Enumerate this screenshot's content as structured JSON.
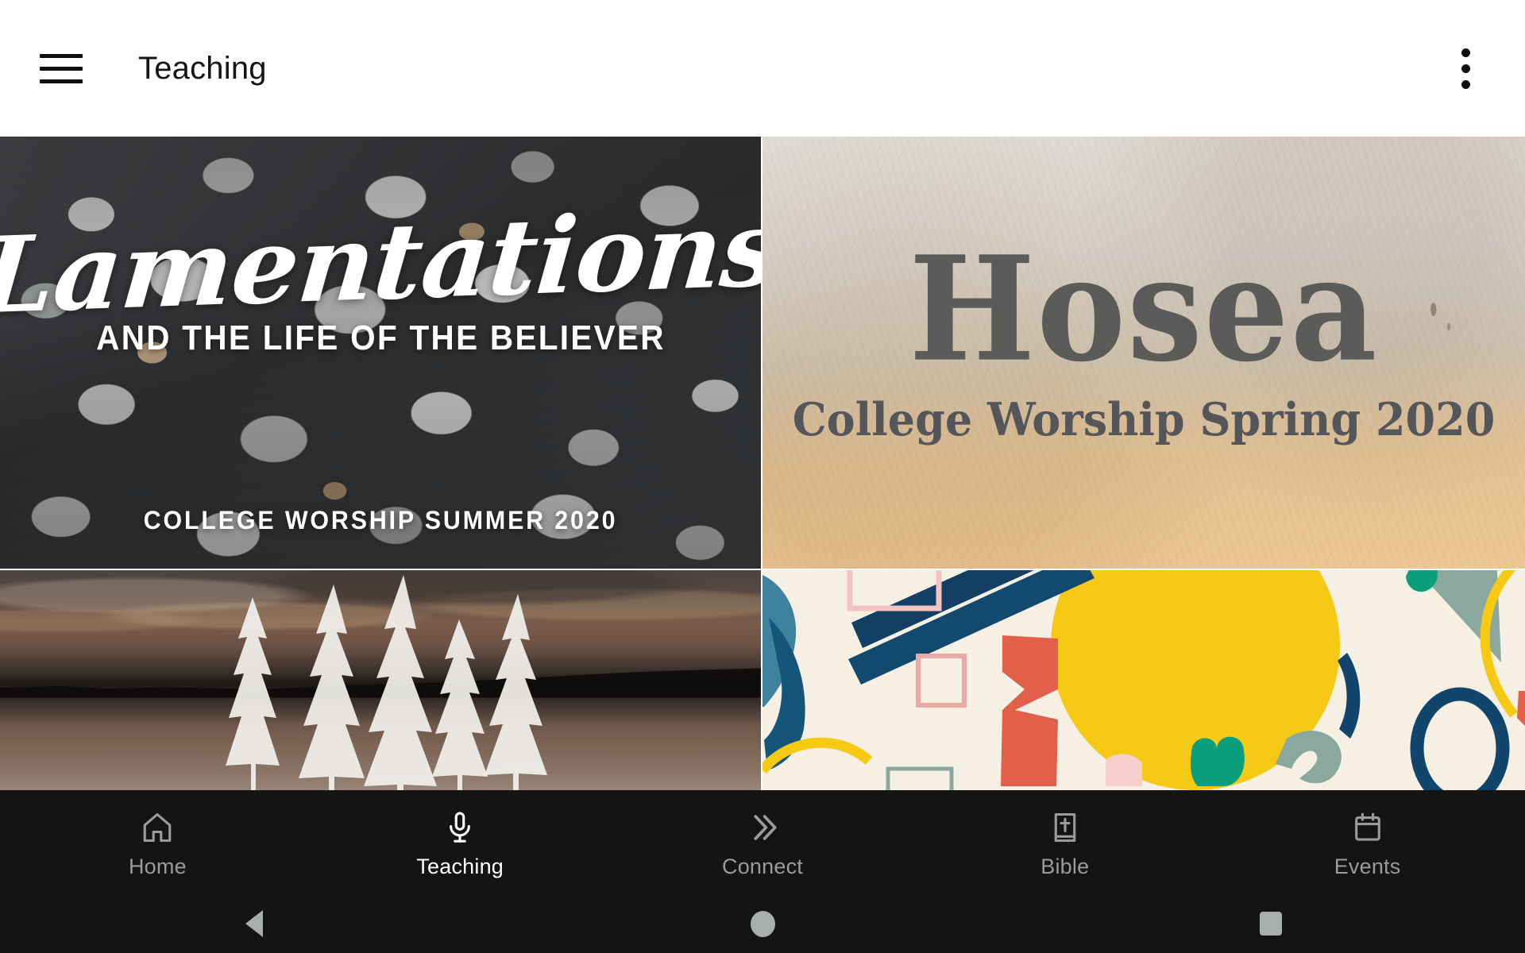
{
  "header": {
    "menu_icon": "hamburger-menu-icon",
    "title": "Teaching",
    "overflow_icon": "more-vertical-icon"
  },
  "content": {
    "cards": [
      {
        "id": "lamentations",
        "title": "Lamentations",
        "subtitle": "AND THE LIFE OF THE BELIEVER",
        "footer": "COLLEGE WORSHIP SUMMER 2020",
        "artwork": "pebbles-beach-photo"
      },
      {
        "id": "hosea",
        "title": "Hosea",
        "subtitle": "College Worship Spring 2020",
        "artwork": "parchment-texture"
      },
      {
        "id": "lake-sunset-series",
        "title": "",
        "subtitle": "",
        "artwork": "lake-sunset-pine-trees-photo"
      },
      {
        "id": "abstract-shapes-series",
        "title": "",
        "subtitle": "",
        "artwork": "abstract-painted-shapes"
      }
    ]
  },
  "tabbar": {
    "items": [
      {
        "label": "Home",
        "icon": "home-icon",
        "active": false
      },
      {
        "label": "Teaching",
        "icon": "microphone-icon",
        "active": true
      },
      {
        "label": "Connect",
        "icon": "double-chevron-right-icon",
        "active": false
      },
      {
        "label": "Bible",
        "icon": "bible-book-icon",
        "active": false
      },
      {
        "label": "Events",
        "icon": "calendar-icon",
        "active": false
      }
    ]
  },
  "systemnav": {
    "back": "back-triangle-icon",
    "home": "home-circle-icon",
    "recents": "recents-square-icon"
  },
  "colors": {
    "appbar_bg": "#ffffff",
    "appbar_text": "#151515",
    "tabbar_bg": "#141414",
    "tab_active": "#ffffff",
    "tab_inactive": "#9b9b9b",
    "sysnav_icon": "#a9adae"
  }
}
